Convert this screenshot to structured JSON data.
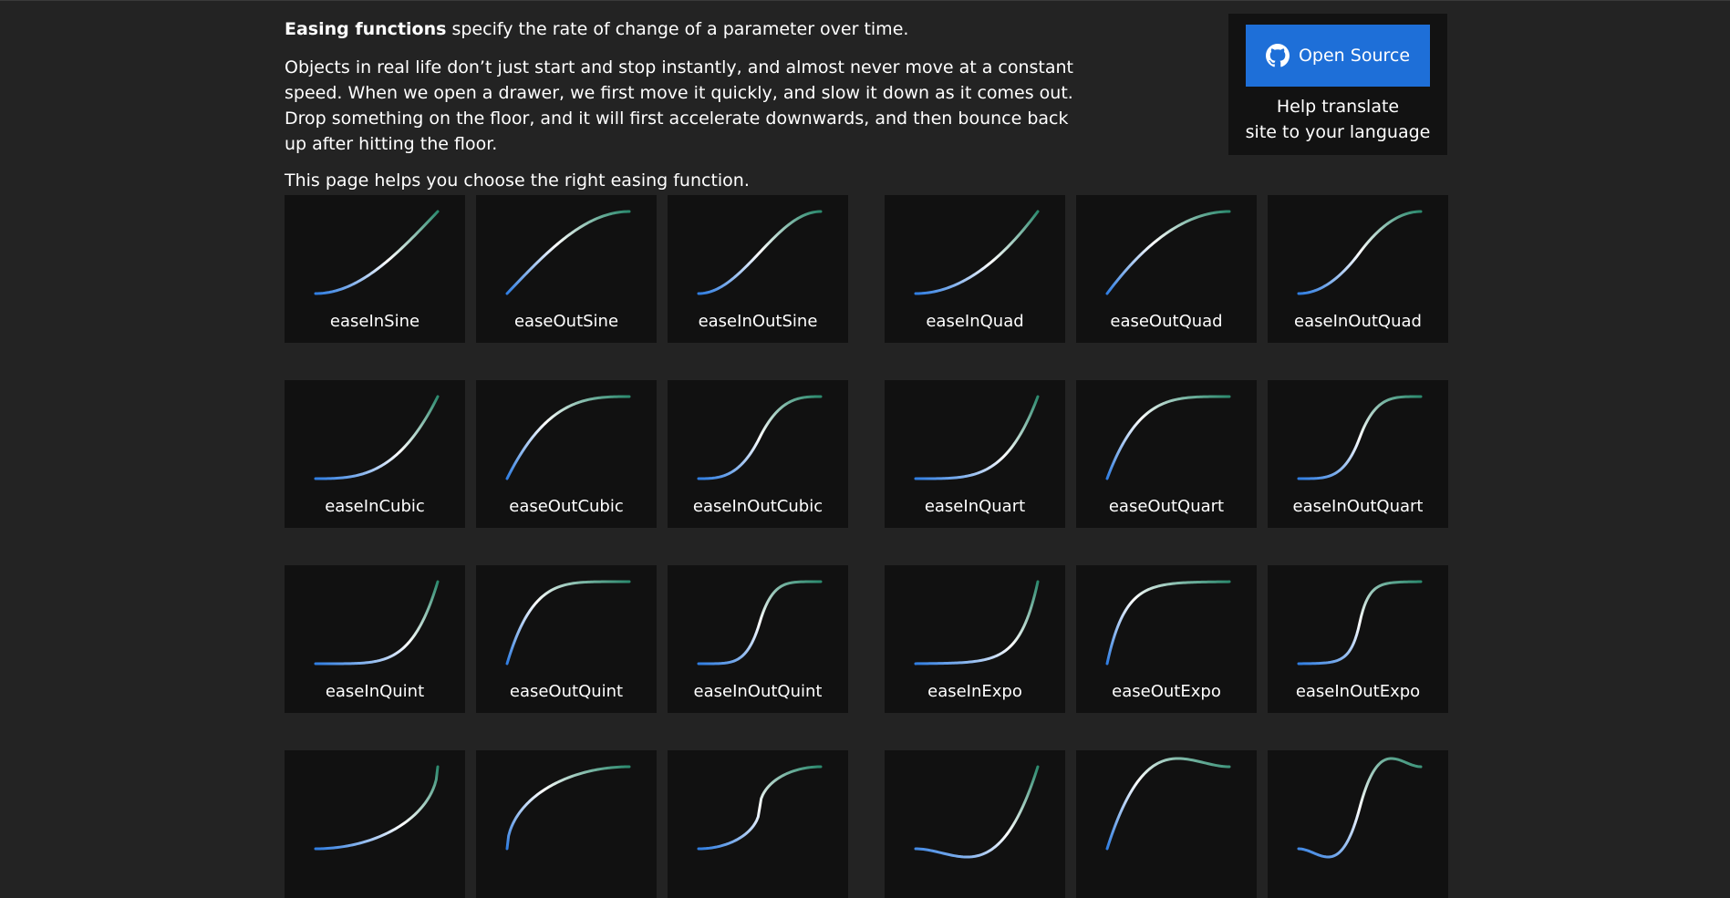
{
  "intro": {
    "lead_bold": "Easing functions",
    "lead_rest": " specify the rate of change of a parameter over time.",
    "body": "Objects in real life don’t just start and stop instantly, and almost never move at a constant speed. When we open a drawer, we first move it quickly, and slow it down as it comes out. Drop something on the floor, and it will first accelerate downwards, and then bounce back up after hitting the floor.",
    "closing": "This page helps you choose the right easing function."
  },
  "sidebar": {
    "open_source_label": "Open Source",
    "open_source_icon": "github-icon",
    "help_line1": "Help translate",
    "help_line2": "site to your language"
  },
  "colors": {
    "background": "#232323",
    "card": "#111111",
    "button": "#1e6fd8",
    "curve_start": "#2f7de1",
    "curve_mid": "#ffffff",
    "curve_end": "#2b8a6e"
  },
  "easings": [
    {
      "name": "easeInSine",
      "fn": "inSine"
    },
    {
      "name": "easeOutSine",
      "fn": "outSine"
    },
    {
      "name": "easeInOutSine",
      "fn": "inOutSine"
    },
    {
      "name": "easeInQuad",
      "fn": "inQuad"
    },
    {
      "name": "easeOutQuad",
      "fn": "outQuad"
    },
    {
      "name": "easeInOutQuad",
      "fn": "inOutQuad"
    },
    {
      "name": "easeInCubic",
      "fn": "inCubic"
    },
    {
      "name": "easeOutCubic",
      "fn": "outCubic"
    },
    {
      "name": "easeInOutCubic",
      "fn": "inOutCubic"
    },
    {
      "name": "easeInQuart",
      "fn": "inQuart"
    },
    {
      "name": "easeOutQuart",
      "fn": "outQuart"
    },
    {
      "name": "easeInOutQuart",
      "fn": "inOutQuart"
    },
    {
      "name": "easeInQuint",
      "fn": "inQuint"
    },
    {
      "name": "easeOutQuint",
      "fn": "outQuint"
    },
    {
      "name": "easeInOutQuint",
      "fn": "inOutQuint"
    },
    {
      "name": "easeInExpo",
      "fn": "inExpo"
    },
    {
      "name": "easeOutExpo",
      "fn": "outExpo"
    },
    {
      "name": "easeInOutExpo",
      "fn": "inOutExpo"
    },
    {
      "name": "",
      "fn": "inCirc"
    },
    {
      "name": "",
      "fn": "outCirc"
    },
    {
      "name": "",
      "fn": "inOutCirc"
    },
    {
      "name": "",
      "fn": "inBack"
    },
    {
      "name": "",
      "fn": "outBack"
    },
    {
      "name": "",
      "fn": "inOutBack"
    }
  ]
}
